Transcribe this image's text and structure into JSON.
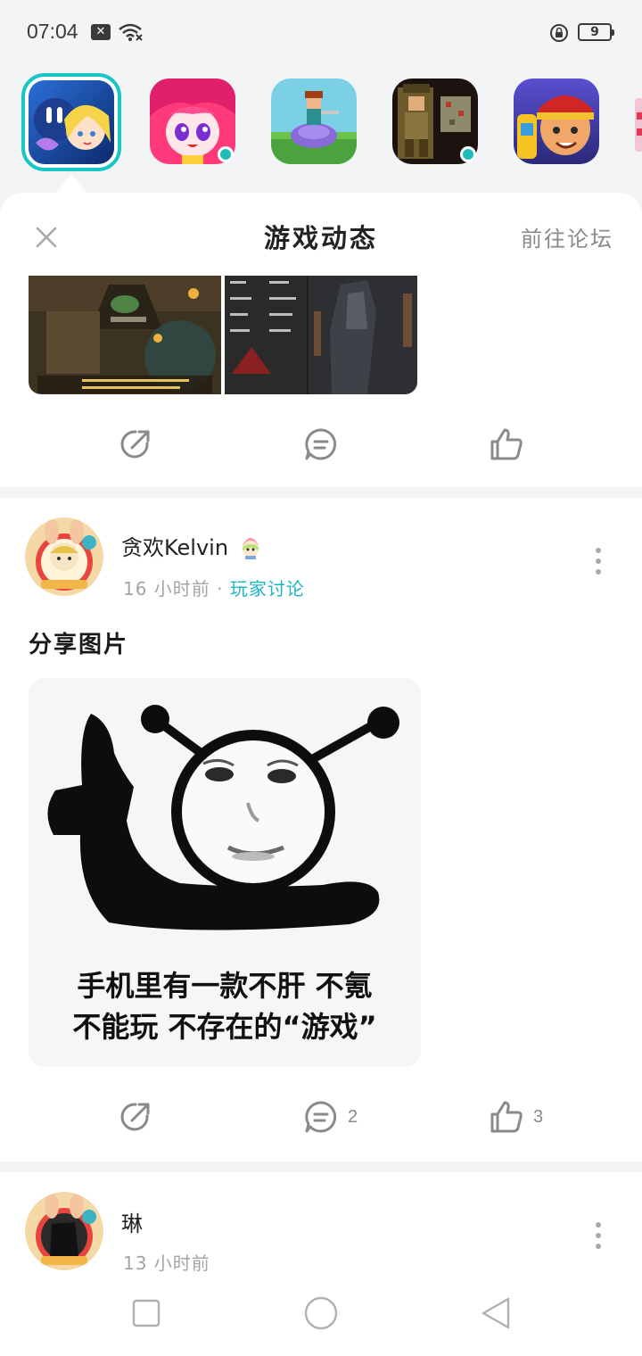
{
  "status_bar": {
    "time": "07:04",
    "battery": "9"
  },
  "games": [
    {
      "icon": "game-icon-anime-girl-blue",
      "selected": true
    },
    {
      "icon": "game-icon-anime-girl-pink",
      "selected": false,
      "has_update": true
    },
    {
      "icon": "game-icon-pixel-rider",
      "selected": false
    },
    {
      "icon": "game-icon-terraria",
      "selected": false,
      "has_update": true
    },
    {
      "icon": "game-icon-subway-surfers",
      "selected": false
    }
  ],
  "sheet": {
    "title": "游戏动态",
    "forum_link": "前往论坛"
  },
  "posts": [
    {
      "actions": {
        "comments": "",
        "likes": ""
      }
    },
    {
      "author": "贪欢Kelvin",
      "time": "16 小时前",
      "separator": "·",
      "tag": "玩家讨论",
      "text": "分享图片",
      "meme_caption_line1": "手机里有一款不肝 不氪",
      "meme_caption_line2": "不能玩 不存在的“游戏”",
      "actions": {
        "comments": "2",
        "likes": "3"
      }
    },
    {
      "author": "琳",
      "time": "13 小时前"
    }
  ],
  "colors": {
    "accent": "#1db7c4",
    "selection_border": "#19c6c6",
    "background": "#f3f4f6"
  }
}
